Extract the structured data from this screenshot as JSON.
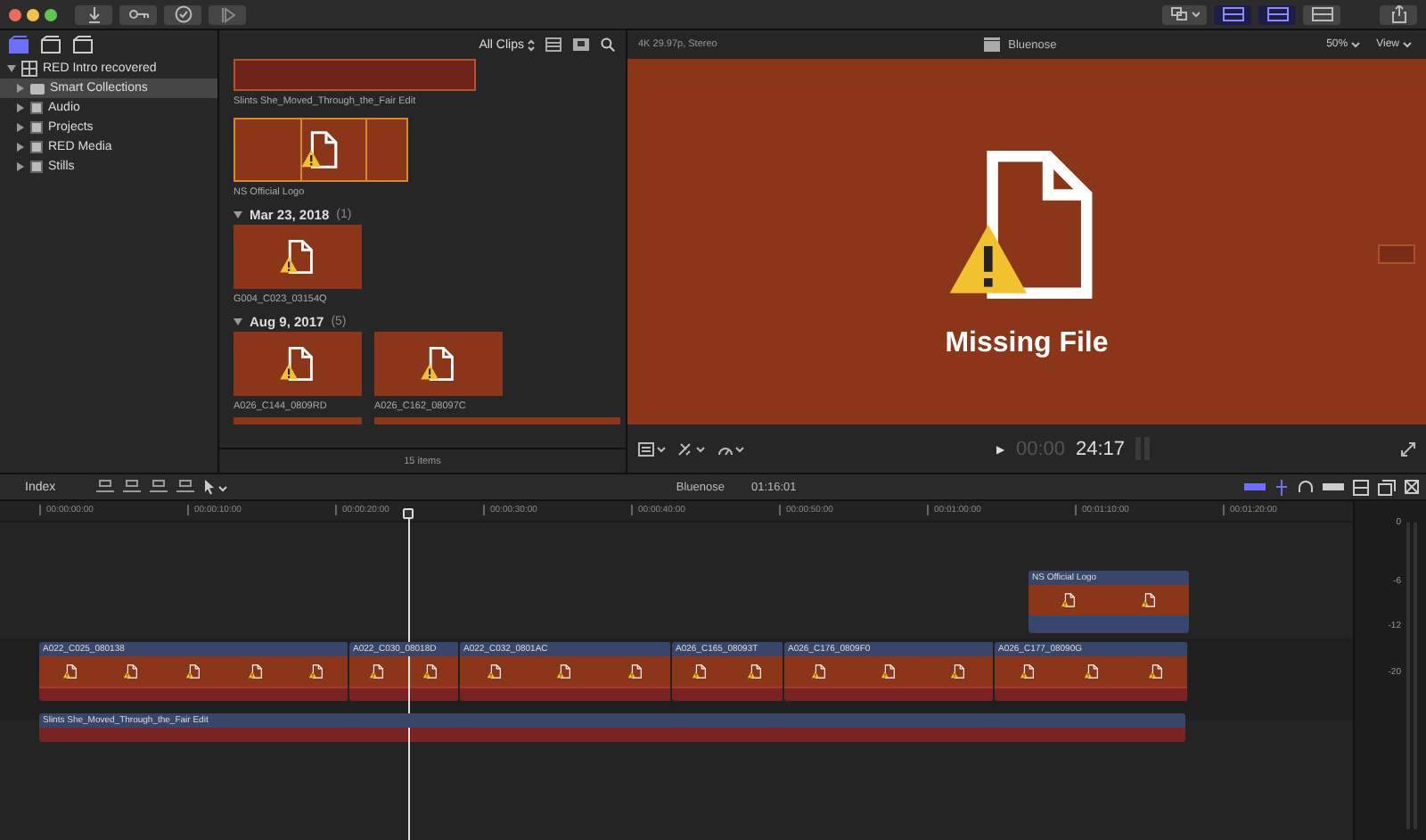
{
  "toolbar": {
    "workspace_toggles": [
      {
        "on": true
      },
      {
        "on": true
      },
      {
        "on": false
      }
    ]
  },
  "sidebar": {
    "tabs": [
      {
        "selected": true
      },
      {
        "selected": false
      },
      {
        "selected": false
      }
    ],
    "library": {
      "name": "RED Intro recovered",
      "expanded": true,
      "children": [
        {
          "name": "Smart Collections",
          "selected": true,
          "expanded": false
        },
        {
          "name": "Audio",
          "selected": false,
          "expanded": false
        },
        {
          "name": "Projects",
          "selected": false,
          "expanded": false
        },
        {
          "name": "RED Media",
          "selected": false,
          "expanded": false
        },
        {
          "name": "Stills",
          "selected": false,
          "expanded": false
        }
      ]
    }
  },
  "browser": {
    "filter": "All Clips",
    "groups": [
      {
        "clips": [
          {
            "name": "Slints She_Moved_Through_the_Fair Edit",
            "kind": "cut",
            "selected": false
          },
          {
            "name": "NS Official Logo",
            "kind": "filmstrip",
            "selected": true
          }
        ]
      },
      {
        "date": "Mar 23, 2018",
        "count": "(1)",
        "expanded": true,
        "clips": [
          {
            "name": "G004_C023_03154Q",
            "kind": "single",
            "selected": false
          }
        ]
      },
      {
        "date": "Aug 9, 2017",
        "count": "(5)",
        "expanded": true,
        "clips": [
          {
            "name": "A026_C144_0809RD",
            "kind": "single",
            "selected": false
          },
          {
            "name": "A026_C162_08097C",
            "kind": "single",
            "selected": false
          }
        ]
      }
    ],
    "footer": "15 items"
  },
  "viewer": {
    "format": "4K 29.97p, Stereo",
    "title": "Bluenose",
    "zoom": "50%",
    "view": "View",
    "message": "Missing File",
    "play": "▶",
    "timecode_dim": "00:00",
    "timecode": "24:17"
  },
  "timeline": {
    "index": "Index",
    "project": "Bluenose",
    "duration": "01:16:01",
    "ruler": [
      "00:00:00:00",
      "00:00:10:00",
      "00:00:20:00",
      "00:00:30:00",
      "00:00:40:00",
      "00:00:50:00",
      "00:01:00:00",
      "00:01:10:00",
      "00:01:20:00"
    ],
    "connected": [
      {
        "name": "NS Official Logo"
      }
    ],
    "primary": [
      {
        "name": "A022_C025_080138"
      },
      {
        "name": "A022_C030_08018D"
      },
      {
        "name": "A022_C032_0801AC"
      },
      {
        "name": "A026_C165_08093T"
      },
      {
        "name": "A026_C176_0809F0"
      },
      {
        "name": "A026_C177_08090G"
      }
    ],
    "audio": [
      {
        "name": "Slints She_Moved_Through_the_Fair Edit"
      }
    ]
  },
  "meter": {
    "scale": [
      "0",
      "-6",
      "-12",
      "-20"
    ]
  }
}
